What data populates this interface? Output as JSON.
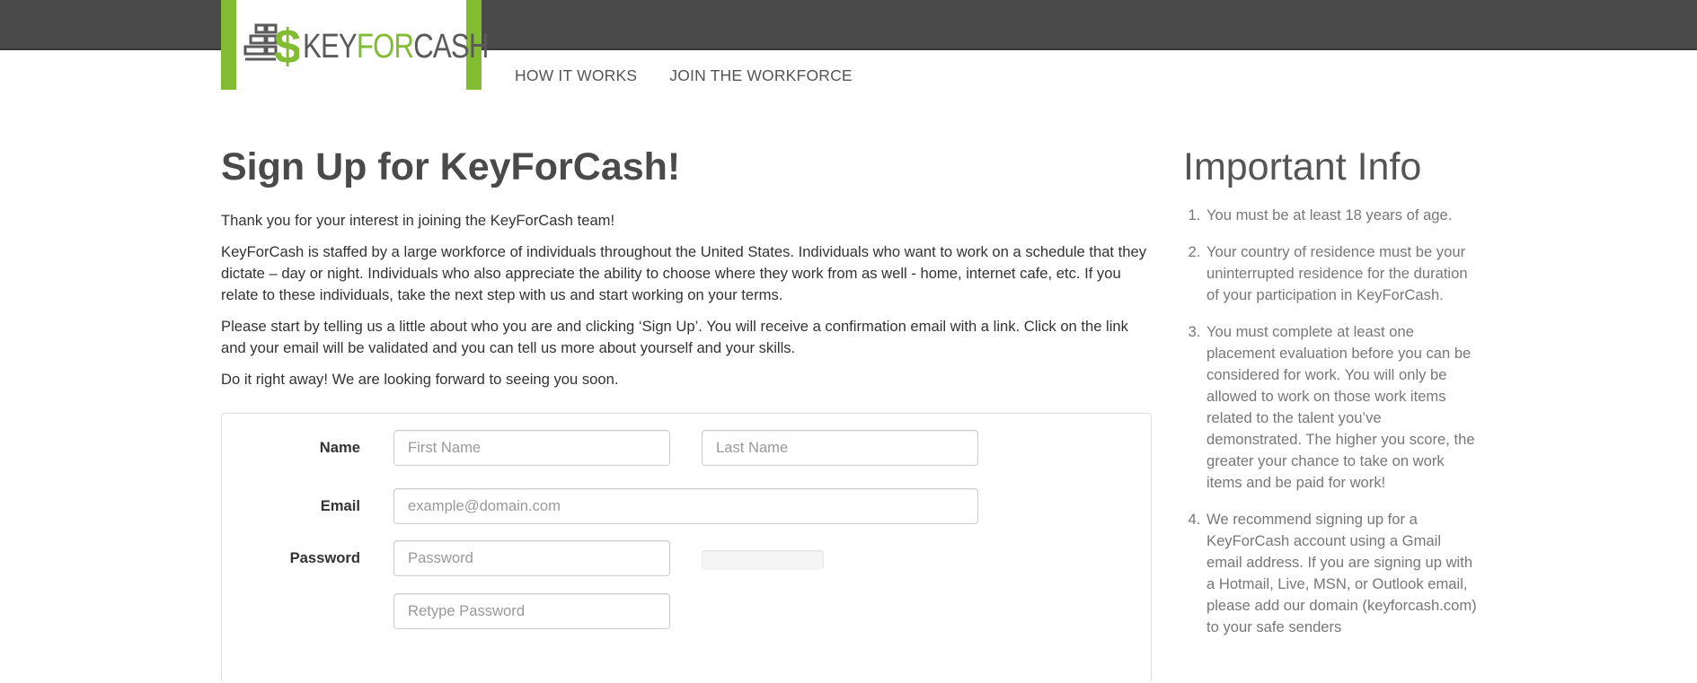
{
  "brand": {
    "name_part1": "KEY",
    "name_part2": "FOR",
    "name_part3": "CASH",
    "accent_color": "#82bc32",
    "topbar_color": "#4a4a4a"
  },
  "nav": {
    "items": [
      {
        "label": "HOW IT WORKS"
      },
      {
        "label": "JOIN THE WORKFORCE"
      }
    ]
  },
  "main": {
    "title": "Sign Up for KeyForCash!",
    "paragraphs": [
      "Thank you for your interest in joining the KeyForCash team!",
      "KeyForCash is staffed by a large workforce of individuals throughout the United States. Individuals who want to work on a schedule that they dictate – day or night. Individuals who also appreciate the ability to choose where they work from as well - home, internet cafe, etc. If you relate to these individuals, take the next step with us and start working on your terms.",
      "Please start by telling us a little about who you are and clicking ‘Sign Up’. You will receive a confirmation email with a link. Click on the link and your email will be validated and you can tell us more about yourself and your skills.",
      "Do it right away! We are looking forward to seeing you soon."
    ]
  },
  "form": {
    "name_label": "Name",
    "first_name_placeholder": "First Name",
    "last_name_placeholder": "Last Name",
    "email_label": "Email",
    "email_placeholder": "example@domain.com",
    "password_label": "Password",
    "password_placeholder": "Password",
    "retype_placeholder": "Retype Password"
  },
  "side": {
    "title": "Important Info",
    "items": [
      "You must be at least 18 years of age.",
      "Your country of residence must be your uninterrupted residence for the duration of your participation in KeyForCash.",
      "You must complete at least one placement evaluation before you can be considered for work. You will only be allowed to work on those work items related to the talent you’ve demonstrated. The higher you score, the greater your chance to take on work items and be paid for work!",
      "We recommend signing up for a KeyForCash account using a Gmail email address. If you are signing up with a Hotmail, Live, MSN, or Outlook email, please add our domain (keyforcash.com) to your safe senders"
    ]
  }
}
